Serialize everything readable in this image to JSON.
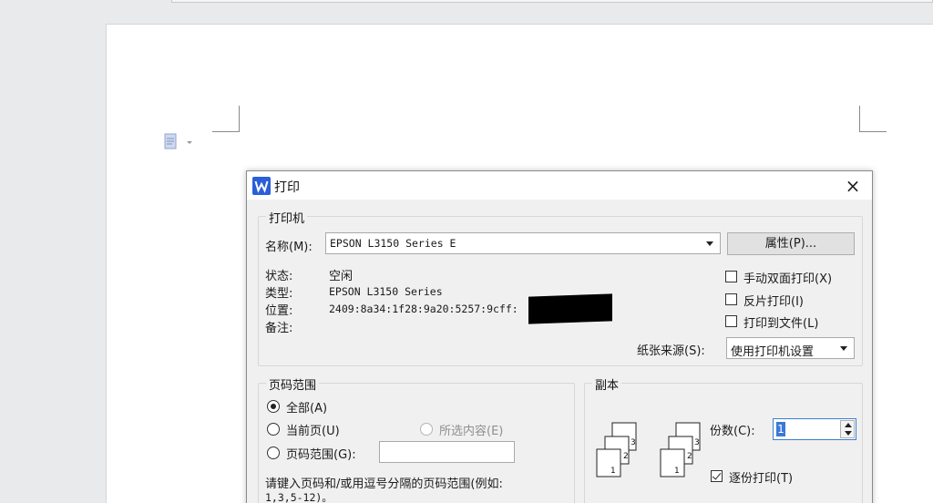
{
  "dialog": {
    "title": "打印",
    "close": "×",
    "icon": "wps-writer-logo"
  },
  "printer": {
    "group_label": "打印机",
    "name_label": "名称(M):",
    "name_value": "EPSON L3150 Series E",
    "properties_button": "属性(P)...",
    "status_label": "状态:",
    "status_value": "空闲",
    "type_label": "类型:",
    "type_value": "EPSON L3150 Series",
    "location_label": "位置:",
    "location_value": "2409:8a34:1f28:9a20:5257:9cff:",
    "comment_label": "备注:",
    "manual_duplex": "手动双面打印(X)",
    "reverse_print": "反片打印(I)",
    "print_to_file": "打印到文件(L)",
    "paper_source_label": "纸张来源(S):",
    "paper_source_value": "使用打印机设置"
  },
  "page_range": {
    "group_label": "页码范围",
    "all": "全部(A)",
    "current_page": "当前页(U)",
    "selection": "所选内容(E)",
    "pages": "页码范围(G):",
    "hint_line1": "请键入页码和/或用逗号分隔的页码范围(例如:",
    "hint_line2": "1,3,5-12)。"
  },
  "copies": {
    "group_label": "副本",
    "count_label": "份数(C):",
    "count_value": "1",
    "collate": "逐份打印(T)",
    "icon_pages": [
      "3",
      "2",
      "1"
    ]
  },
  "colors": {
    "wps_blue": "#2b5fd9",
    "focus_blue": "#3b78d8"
  }
}
